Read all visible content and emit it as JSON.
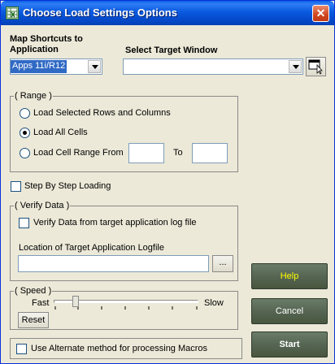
{
  "window": {
    "title": "Choose Load Settings Options",
    "close_glyph": "✕",
    "app_icon": "excel-sheet-icon"
  },
  "map_shortcuts": {
    "label": "Map Shortcuts to Application",
    "selected": "Apps 11i/R12"
  },
  "target_window": {
    "label": "Select Target Window",
    "value": "",
    "picker_icon": "window-picker-icon"
  },
  "range": {
    "legend": "( Range )",
    "options": [
      "Load Selected Rows and Columns",
      "Load All Cells",
      "Load Cell Range From"
    ],
    "selected_index": 1,
    "from_value": "",
    "to_label": "To",
    "to_value": ""
  },
  "step_by_step": {
    "label": "Step By Step Loading",
    "checked": false
  },
  "verify": {
    "legend": "( Verify Data )",
    "check_label": "Verify Data from target application log file",
    "checked": false,
    "location_label": "Location of Target Application Logfile",
    "location_value": "",
    "browse_label": "..."
  },
  "speed": {
    "legend": "( Speed )",
    "fast_label": "Fast",
    "slow_label": "Slow",
    "level": 0.15,
    "reset_label": "Reset"
  },
  "alternate": {
    "label": "Use Alternate method for processing Macros",
    "checked": false
  },
  "buttons": {
    "help": "Help",
    "cancel": "Cancel",
    "start": "Start"
  },
  "colors": {
    "titlebar": "#0a5ae0",
    "dialog_bg": "#ece9d8",
    "help_text": "#ffff00",
    "action_button": "#566653"
  }
}
